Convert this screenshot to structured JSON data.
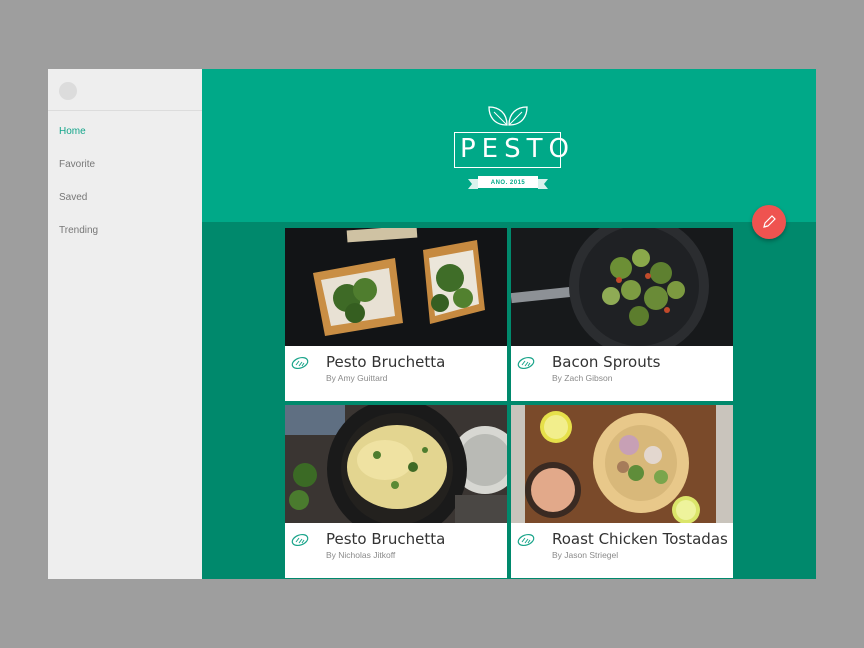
{
  "sidebar": {
    "items": [
      {
        "label": "Home",
        "active": true
      },
      {
        "label": "Favorite",
        "active": false
      },
      {
        "label": "Saved",
        "active": false
      },
      {
        "label": "Trending",
        "active": false
      }
    ]
  },
  "header": {
    "logo_text": "PESTO",
    "logo_tagline": "ANO. 2015",
    "background": "#00a988"
  },
  "fab": {
    "icon": "pencil-icon",
    "color": "#ef5350"
  },
  "cards": [
    {
      "title": "Pesto Bruchetta",
      "author": "By Amy Guittard",
      "icon": "bread-icon",
      "photo": "bruschetta-photo"
    },
    {
      "title": "Bacon Sprouts",
      "author": "By Zach Gibson",
      "icon": "bread-icon",
      "photo": "sprouts-pan-photo"
    },
    {
      "title": "Pesto Bruchetta",
      "author": "By Nicholas Jitkoff",
      "icon": "bread-icon",
      "photo": "pasta-pan-photo"
    },
    {
      "title": "Roast Chicken Tostadas",
      "author": "By Jason Striegel",
      "icon": "bread-icon",
      "photo": "tostadas-photo"
    }
  ],
  "colors": {
    "accent": "#13a58a",
    "content_bg": "#00896c",
    "sidebar_bg": "#eeeeee"
  }
}
